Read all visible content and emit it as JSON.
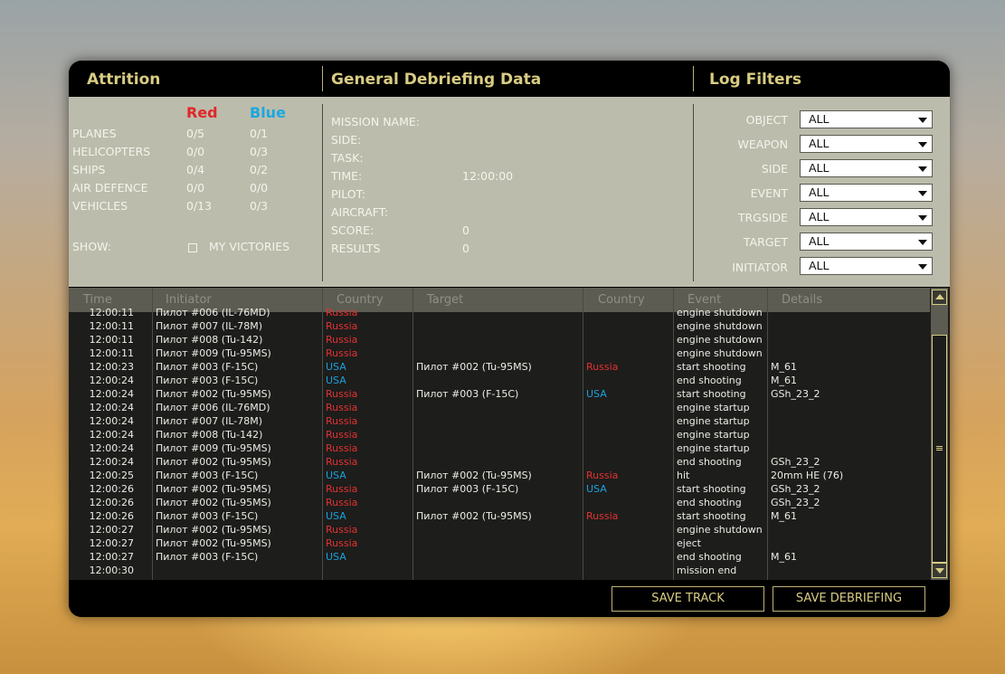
{
  "headers": {
    "attrition": "Attrition",
    "general": "General Debriefing Data",
    "filters": "Log Filters"
  },
  "attrition": {
    "red_label": "Red",
    "blue_label": "Blue",
    "rows": [
      {
        "label": "PLANES",
        "red": "0/5",
        "blue": "0/1"
      },
      {
        "label": "HELICOPTERS",
        "red": "0/0",
        "blue": "0/3"
      },
      {
        "label": "SHIPS",
        "red": "0/4",
        "blue": "0/2"
      },
      {
        "label": "AIR DEFENCE",
        "red": "0/0",
        "blue": "0/0"
      },
      {
        "label": "VEHICLES",
        "red": "0/13",
        "blue": "0/3"
      }
    ],
    "show_label": "SHOW:",
    "my_victories_label": "MY VICTORIES"
  },
  "general": {
    "fields": [
      {
        "label": "MISSION NAME:",
        "value": ""
      },
      {
        "label": "SIDE:",
        "value": ""
      },
      {
        "label": "TASK:",
        "value": ""
      },
      {
        "label": "TIME:",
        "value": "12:00:00"
      },
      {
        "label": "PILOT:",
        "value": ""
      },
      {
        "label": "AIRCRAFT:",
        "value": ""
      },
      {
        "label": "SCORE:",
        "value": "0"
      },
      {
        "label": "RESULTS",
        "value": "0"
      }
    ]
  },
  "filters": [
    {
      "label": "OBJECT",
      "value": "ALL"
    },
    {
      "label": "WEAPON",
      "value": "ALL"
    },
    {
      "label": "SIDE",
      "value": "ALL"
    },
    {
      "label": "EVENT",
      "value": "ALL"
    },
    {
      "label": "TRGSIDE",
      "value": "ALL"
    },
    {
      "label": "TARGET",
      "value": "ALL"
    },
    {
      "label": "INITIATOR",
      "value": "ALL"
    }
  ],
  "log": {
    "columns": [
      "Time",
      "Initiator",
      "Country",
      "Target",
      "Country",
      "Event",
      "Details"
    ],
    "rows": [
      {
        "time": "12:00:11",
        "initiator": "Пилот #006 (IL-76MD)",
        "country": "Russia",
        "target": "",
        "tcountry": "",
        "event": "engine shutdown",
        "details": ""
      },
      {
        "time": "12:00:11",
        "initiator": "Пилот #007 (IL-78M)",
        "country": "Russia",
        "target": "",
        "tcountry": "",
        "event": "engine shutdown",
        "details": ""
      },
      {
        "time": "12:00:11",
        "initiator": "Пилот #008 (Tu-142)",
        "country": "Russia",
        "target": "",
        "tcountry": "",
        "event": "engine shutdown",
        "details": ""
      },
      {
        "time": "12:00:11",
        "initiator": "Пилот #009 (Tu-95MS)",
        "country": "Russia",
        "target": "",
        "tcountry": "",
        "event": "engine shutdown",
        "details": ""
      },
      {
        "time": "12:00:23",
        "initiator": "Пилот #003 (F-15C)",
        "country": "USA",
        "target": "Пилот #002 (Tu-95MS)",
        "tcountry": "Russia",
        "event": "start shooting",
        "details": "M_61"
      },
      {
        "time": "12:00:24",
        "initiator": "Пилот #003 (F-15C)",
        "country": "USA",
        "target": "",
        "tcountry": "",
        "event": "end shooting",
        "details": "M_61"
      },
      {
        "time": "12:00:24",
        "initiator": "Пилот #002 (Tu-95MS)",
        "country": "Russia",
        "target": "Пилот #003 (F-15C)",
        "tcountry": "USA",
        "event": "start shooting",
        "details": "GSh_23_2"
      },
      {
        "time": "12:00:24",
        "initiator": "Пилот #006 (IL-76MD)",
        "country": "Russia",
        "target": "",
        "tcountry": "",
        "event": "engine startup",
        "details": ""
      },
      {
        "time": "12:00:24",
        "initiator": "Пилот #007 (IL-78M)",
        "country": "Russia",
        "target": "",
        "tcountry": "",
        "event": "engine startup",
        "details": ""
      },
      {
        "time": "12:00:24",
        "initiator": "Пилот #008 (Tu-142)",
        "country": "Russia",
        "target": "",
        "tcountry": "",
        "event": "engine startup",
        "details": ""
      },
      {
        "time": "12:00:24",
        "initiator": "Пилот #009 (Tu-95MS)",
        "country": "Russia",
        "target": "",
        "tcountry": "",
        "event": "engine startup",
        "details": ""
      },
      {
        "time": "12:00:24",
        "initiator": "Пилот #002 (Tu-95MS)",
        "country": "Russia",
        "target": "",
        "tcountry": "",
        "event": "end shooting",
        "details": "GSh_23_2"
      },
      {
        "time": "12:00:25",
        "initiator": "Пилот #003 (F-15C)",
        "country": "USA",
        "target": "Пилот #002 (Tu-95MS)",
        "tcountry": "Russia",
        "event": "hit",
        "details": "20mm HE (76)"
      },
      {
        "time": "12:00:26",
        "initiator": "Пилот #002 (Tu-95MS)",
        "country": "Russia",
        "target": "Пилот #003 (F-15C)",
        "tcountry": "USA",
        "event": "start shooting",
        "details": "GSh_23_2"
      },
      {
        "time": "12:00:26",
        "initiator": "Пилот #002 (Tu-95MS)",
        "country": "Russia",
        "target": "",
        "tcountry": "",
        "event": "end shooting",
        "details": "GSh_23_2"
      },
      {
        "time": "12:00:26",
        "initiator": "Пилот #003 (F-15C)",
        "country": "USA",
        "target": "Пилот #002 (Tu-95MS)",
        "tcountry": "Russia",
        "event": "start shooting",
        "details": "M_61"
      },
      {
        "time": "12:00:27",
        "initiator": "Пилот #002 (Tu-95MS)",
        "country": "Russia",
        "target": "",
        "tcountry": "",
        "event": "engine shutdown",
        "details": ""
      },
      {
        "time": "12:00:27",
        "initiator": "Пилот #002 (Tu-95MS)",
        "country": "Russia",
        "target": "",
        "tcountry": "",
        "event": "eject",
        "details": ""
      },
      {
        "time": "12:00:27",
        "initiator": "Пилот #003 (F-15C)",
        "country": "USA",
        "target": "",
        "tcountry": "",
        "event": "end shooting",
        "details": "M_61"
      },
      {
        "time": "12:00:30",
        "initiator": "",
        "country": "",
        "target": "",
        "tcountry": "",
        "event": "mission end",
        "details": ""
      }
    ]
  },
  "buttons": {
    "save_track": "SAVE TRACK",
    "save_debriefing": "SAVE DEBRIEFING"
  },
  "colors": {
    "red": "#e23232",
    "blue": "#1aa2dc",
    "accent": "#d8cc82",
    "panel_bg": "#bcbcac"
  }
}
